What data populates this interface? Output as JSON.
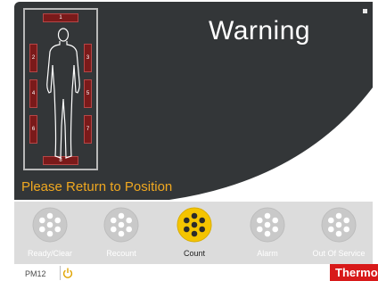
{
  "screen": {
    "title": "Warning",
    "status_message": "Please Return to Position"
  },
  "zones": [
    "1",
    "2",
    "3",
    "4",
    "5",
    "6",
    "7",
    "8"
  ],
  "buttons": [
    {
      "label": "Ready/Clear",
      "icon": "detector-icon",
      "active": false
    },
    {
      "label": "Recount",
      "icon": "detector-icon",
      "active": false
    },
    {
      "label": "Count",
      "icon": "detector-icon",
      "active": true
    },
    {
      "label": "Alarm",
      "icon": "detector-icon",
      "active": false
    },
    {
      "label": "Out Of Service",
      "icon": "detector-icon",
      "active": false
    }
  ],
  "footer": {
    "device": "PM12",
    "power_icon": "power-icon",
    "brand": "Thermo"
  },
  "colors": {
    "screen": "#333638",
    "accent": "#f0a820",
    "active_button": "#f4c400",
    "inactive_button": "#b9b9b9",
    "zone": "#7a1a1a",
    "brand": "#d81a1a"
  }
}
